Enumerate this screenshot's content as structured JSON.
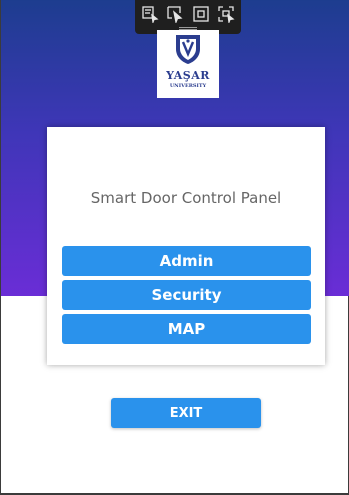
{
  "colors": {
    "gradient_top": "#1d3d8f",
    "gradient_bottom": "#6a2dd6",
    "button": "#2a92ec",
    "toolbar": "#1f1f1f"
  },
  "toolbar": {
    "icons": [
      "select-element-icon",
      "cursor-icon",
      "rectangle-select-icon",
      "fullscreen-select-icon"
    ]
  },
  "logo": {
    "name": "YAŞAR",
    "subtitle": "UNIVERSITY"
  },
  "panel": {
    "title": "Smart Door Control Panel",
    "buttons": [
      "Admin",
      "Security",
      "MAP"
    ]
  },
  "exit_label": "EXIT"
}
